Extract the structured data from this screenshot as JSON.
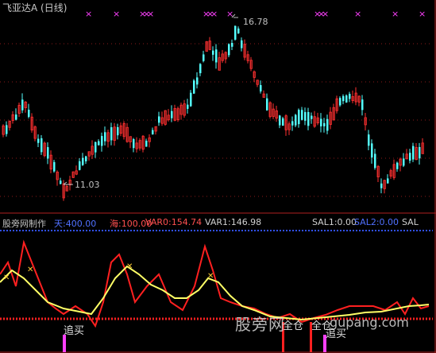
{
  "window": {
    "title": "飞亚达A (日线)"
  },
  "price_panel": {
    "high_label": "16.78",
    "low_label": "11.03",
    "markers": "×"
  },
  "indicator_bar": {
    "name": "股旁网制作",
    "tian": "天:400.00",
    "hai": "海:100.00",
    "var0": "VAR0:154.74",
    "var1": "VAR1:146.98",
    "sal1": "SAL1:0.00",
    "sal2": "SAL2:0.00",
    "sal": "SAL"
  },
  "signals": {
    "zhuimai_left": "追买",
    "zhuimai_right": "追买",
    "quancang_1": "全仓",
    "quancang_2": "全仓"
  },
  "watermark": {
    "text": "股旁网",
    "domain": "gupang.com"
  },
  "colors": {
    "up": "#ff3030",
    "down": "#54ffff",
    "grid": "#8b1a1a",
    "line_yellow": "#ffff66",
    "line_red": "#ff2020",
    "magenta": "#ff40ff",
    "blue_line": "#3050ff"
  }
}
